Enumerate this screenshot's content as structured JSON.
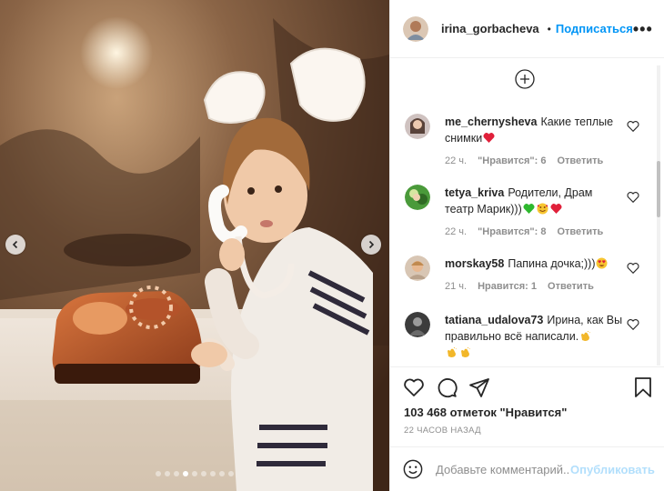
{
  "post": {
    "image_description": "",
    "carousel": {
      "total": 9,
      "active_index": 3
    }
  },
  "header": {
    "username": "irina_gorbacheva",
    "separator": "•",
    "follow_label": "Подписаться",
    "more_label": "•••"
  },
  "comments": [
    {
      "username": "me_chernysheva",
      "text": "Какие теплые снимки",
      "emoji": [
        "red-heart"
      ],
      "time": "22 ч.",
      "likes": "\"Нравится\": 6",
      "reply": "Ответить"
    },
    {
      "username": "tetya_kriva",
      "text": "Родители, Драм театр Марик)))",
      "emoji": [
        "green-heart",
        "smiling-face-with-hearts",
        "red-heart"
      ],
      "time": "22 ч.",
      "likes": "\"Нравится\": 8",
      "reply": "Ответить"
    },
    {
      "username": "morskay58",
      "text": "Папина дочка;)))",
      "emoji": [
        "heart-eyes"
      ],
      "time": "21 ч.",
      "likes": "Нравится: 1",
      "reply": "Ответить"
    },
    {
      "username": "tatiana_udalova73",
      "text": "Ирина, как Вы правильно всё написали.",
      "emoji": [
        "clap",
        "clap",
        "clap"
      ],
      "time": "",
      "likes": "",
      "reply": ""
    }
  ],
  "actions": {
    "likes_text": "103 468 отметок \"Нравится\"",
    "posted_time": "22 ЧАСОВ НАЗАД"
  },
  "add_comment": {
    "placeholder": "Добавьте комментарий...",
    "publish_label": "Опубликовать"
  },
  "colors": {
    "accent": "#0095f6",
    "publish_disabled": "#b2dffc",
    "muted": "#8e8e8e",
    "text": "#262626"
  }
}
